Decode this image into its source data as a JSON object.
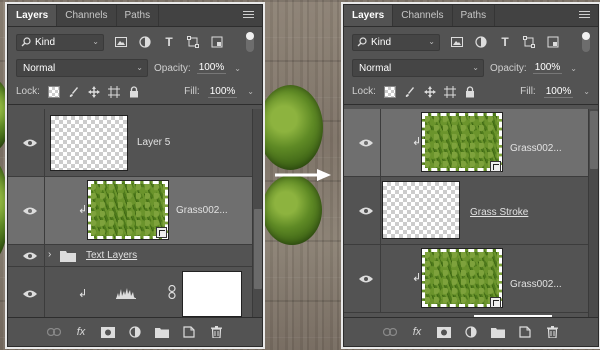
{
  "panels": [
    {
      "tabs": [
        "Layers",
        "Channels",
        "Paths"
      ],
      "kind_label": "Kind",
      "blend_mode": "Normal",
      "opacity_label": "Opacity:",
      "opacity_value": "100%",
      "lock_label": "Lock:",
      "fill_label": "Fill:",
      "fill_value": "100%",
      "layers": [
        {
          "name": "Layer 5"
        },
        {
          "name": "Grass002..."
        },
        {
          "name": "Text Layers"
        },
        {
          "name": ""
        }
      ]
    },
    {
      "tabs": [
        "Layers",
        "Channels",
        "Paths"
      ],
      "kind_label": "Kind",
      "blend_mode": "Normal",
      "opacity_label": "Opacity:",
      "opacity_value": "100%",
      "lock_label": "Lock:",
      "fill_label": "Fill:",
      "fill_value": "100%",
      "layers": [
        {
          "name": "Grass002..."
        },
        {
          "name": "Grass Stroke"
        },
        {
          "name": "Grass002..."
        }
      ]
    }
  ],
  "icons": {
    "menu": "panel-menu-icon",
    "search": "search-icon",
    "clip": "clipping-arrow-icon",
    "eye": "eye-icon",
    "folder": "folder-icon"
  },
  "colors": {
    "panel_bg": "#535353",
    "selected_layer": "#6f6f6f",
    "tab_bar": "#424242"
  }
}
